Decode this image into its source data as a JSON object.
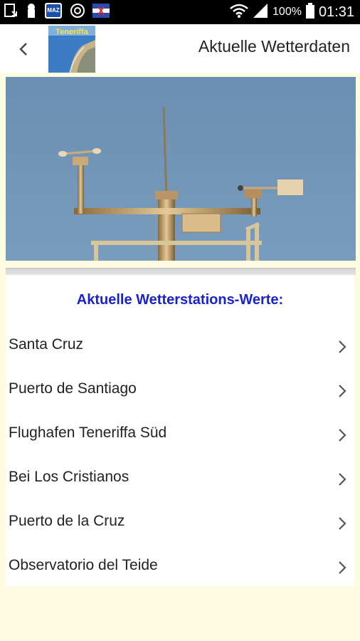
{
  "status_bar": {
    "battery_percent": "100%",
    "time": "01:31",
    "icons": [
      "download-icon",
      "keyhole-icon",
      "app-notification-icon",
      "sync-icon",
      "flag-icon",
      "wifi-icon",
      "signal-icon",
      "battery-icon"
    ]
  },
  "app_bar": {
    "logo_text": "Teneriffa",
    "title": "Aktuelle Wetterdaten"
  },
  "main": {
    "heading": "Aktuelle Wetterstations-Werte:",
    "stations": [
      {
        "label": "Santa Cruz"
      },
      {
        "label": "Puerto de Santiago"
      },
      {
        "label": "Flughafen Teneriffa Süd"
      },
      {
        "label": "Bei Los Cristianos"
      },
      {
        "label": "Puerto de la Cruz"
      },
      {
        "label": "Observatorio del Teide"
      }
    ]
  },
  "colors": {
    "background": "#fdfbe0",
    "heading": "#1a22cc",
    "sky": "#6f93b5"
  }
}
